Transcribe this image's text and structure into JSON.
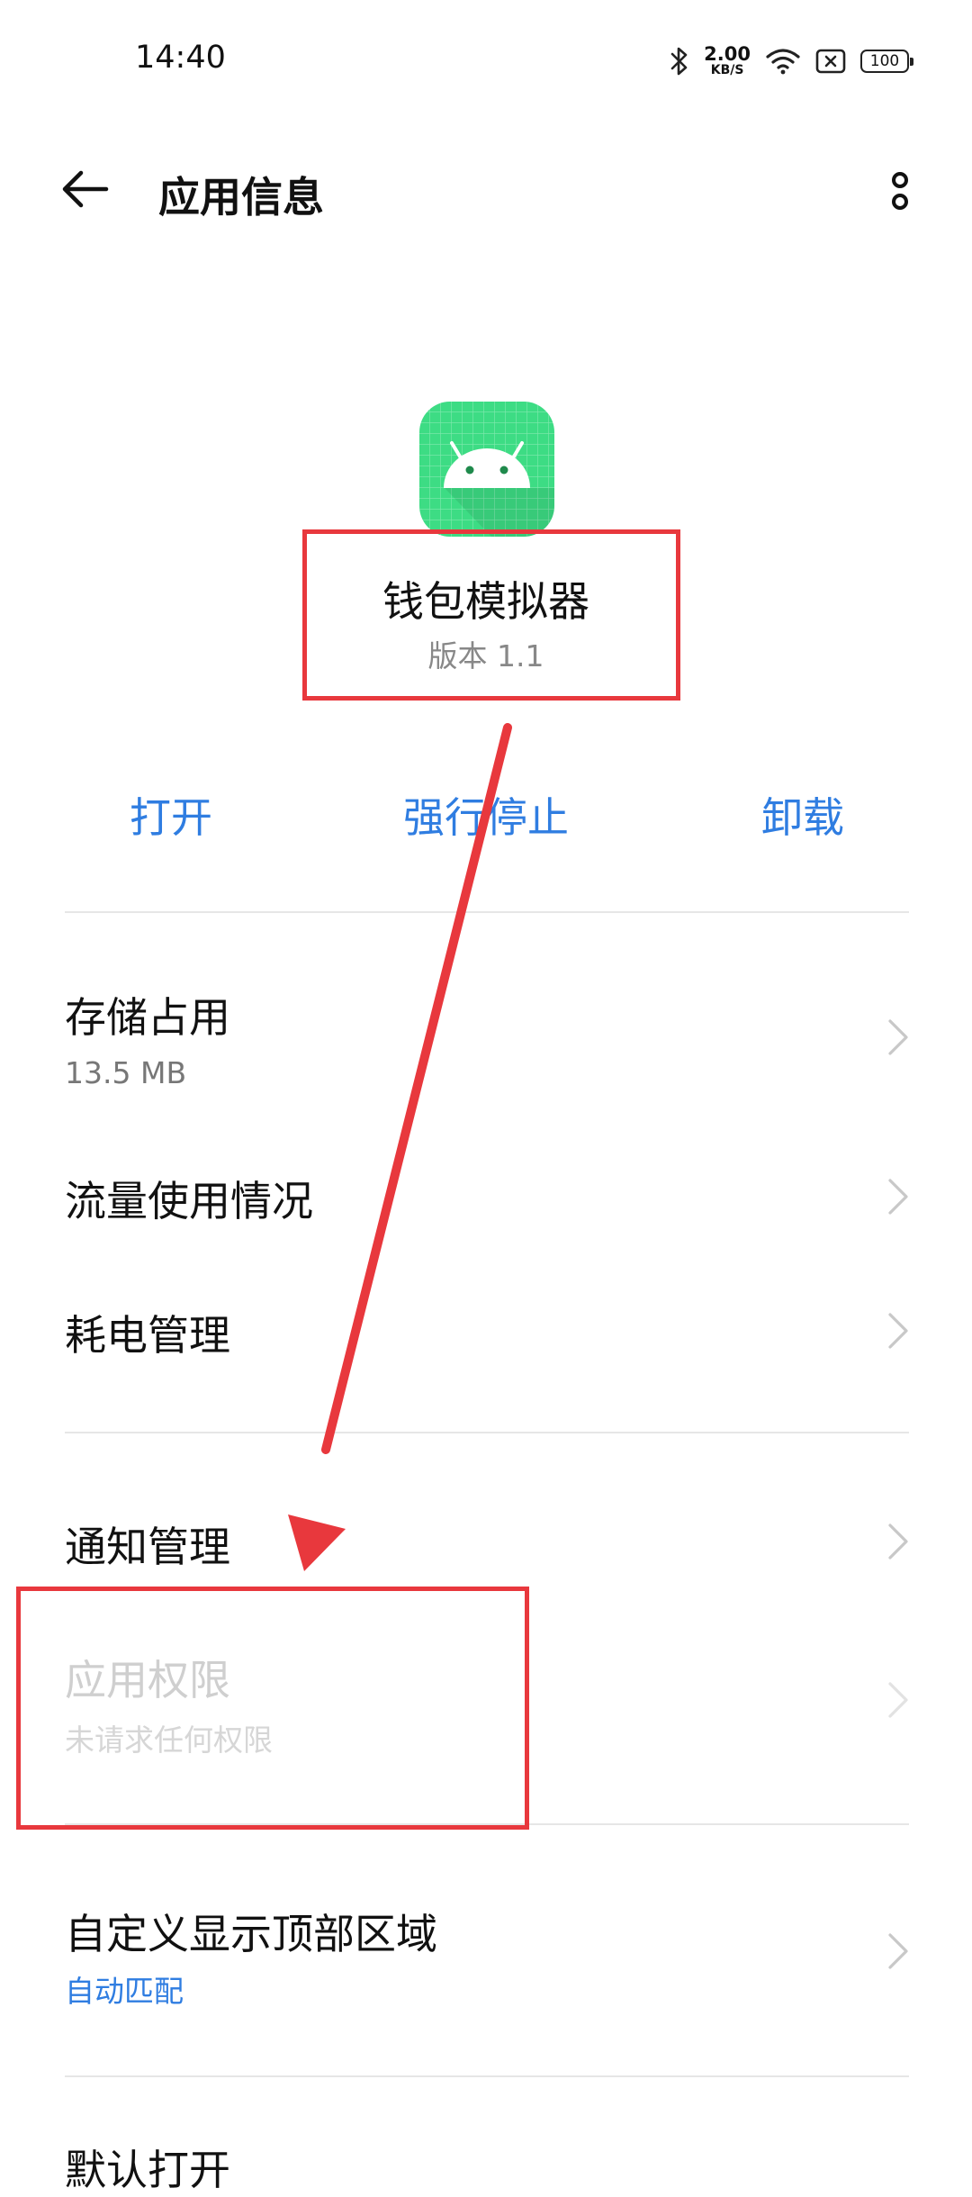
{
  "status_bar": {
    "time": "14:40",
    "net_speed_value": "2.00",
    "net_speed_unit": "KB/S",
    "battery": "100"
  },
  "header": {
    "title": "应用信息"
  },
  "app": {
    "name": "钱包模拟器",
    "version": "版本 1.1",
    "icon_color": "#3ddc84"
  },
  "actions": {
    "open": "打开",
    "force_stop": "强行停止",
    "uninstall": "卸载"
  },
  "settings": {
    "storage": {
      "title": "存储占用",
      "sub": "13.5 MB"
    },
    "data_usage": {
      "title": "流量使用情况"
    },
    "battery": {
      "title": "耗电管理"
    },
    "notifications": {
      "title": "通知管理"
    },
    "permissions": {
      "title": "应用权限",
      "sub": "未请求任何权限"
    },
    "top_area": {
      "title": "自定义显示顶部区域",
      "sub": "自动匹配"
    },
    "open_by_default": {
      "title": "默认打开"
    }
  },
  "colors": {
    "accent": "#2f7de1",
    "annotation": "#e8383d"
  }
}
